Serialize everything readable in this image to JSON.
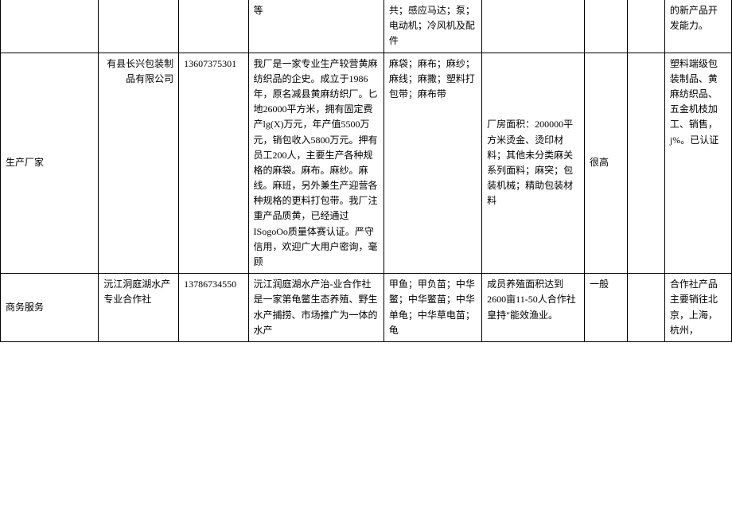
{
  "rows": [
    {
      "c1": "",
      "c2": "",
      "c3": "",
      "c4": "等",
      "c5": "共；感应马达；泵；电动机；冷风机及配件",
      "c6": "",
      "c7": "",
      "c8": "",
      "c9": "的新产品开发能力。"
    },
    {
      "c1": "生产厂家",
      "c2": "有县长兴包装制品有限公司",
      "c3": "13607375301",
      "c4": "我厂是一家专业生产较营黄麻纺织品的企史。成立于1986年，原名减县黄麻纺织厂。匕地26000平方米，拥有固定费产lg(X)万元，年产值5500万元，销包收入5800万元。押有员工200人，主要生产各种规格的麻袋。麻布。麻纱。麻线。麻班，另外兼生产迎营各种规格的更料打包带。我厂注重产品质黄，已经通过ISogoOo质量体赛认证。严守信用，欢迎广大用户密询，毫顾",
      "c5": "麻袋；麻布；麻纱；麻线；麻撒；塑料打包带；麻布带",
      "c6": "厂房面积：200000平方米烫金、烫印材料；其他未分类麻关系列面料；麻突；包装机械；精助包装材料",
      "c7": "很高",
      "c8": "",
      "c9": "塑料端级包装制品、黄麻纺织品、五金机枝加工、销售，j%。已认证"
    },
    {
      "c1": "商务服务",
      "c2": "沅江洞庭湖水产专业合作社",
      "c3": "13786734550",
      "c4": "沅江润庭湖水产治-业合作社是一家第龟鳖生态养殖、野生水产捕捞、市场推广为一体的水产",
      "c5": "甲鱼；甲负苗；中华鳖；中华鳖苗；中华单龟；中华草电苗；龟",
      "c6": "成员养殖面积达到2600亩11-50人合作社皇持\"能效渔业。",
      "c7": "一般",
      "c8": "",
      "c9": "合作社产品主要销往北京，上海，杭州，"
    }
  ]
}
